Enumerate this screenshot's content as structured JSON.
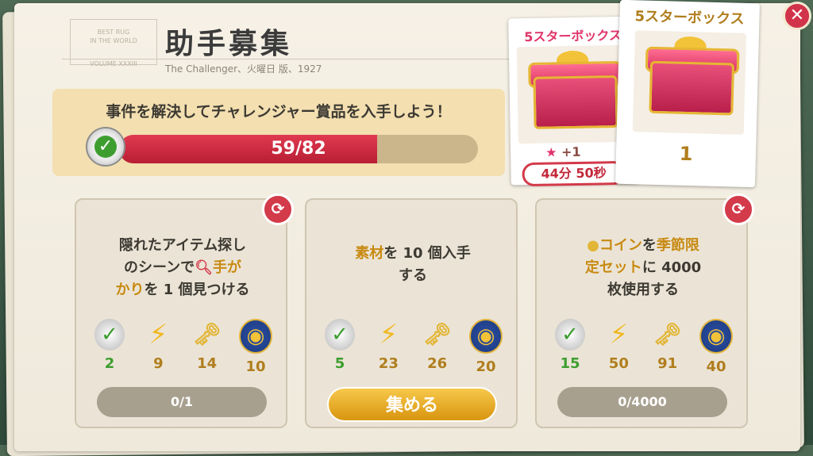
{
  "header": {
    "stamp_line1": "BEST RUG",
    "stamp_line2": "IN THE WORLD",
    "stamp_line3": "VOLUME XXXIII",
    "title": "助手募集",
    "subtitle": "The Challenger、火曜日 版、1927"
  },
  "banner": {
    "text": "事件を解決してチャレンジャー賞品を入手しよう！",
    "progress_current": 59,
    "progress_total": 82,
    "progress_label": "59/82"
  },
  "rewards": [
    {
      "title": "5スターボックス",
      "plus": "+1",
      "timer": "44分 50秒"
    },
    {
      "title": "5スターボックス",
      "count": "1"
    }
  ],
  "missions": [
    {
      "desc_line1": "隠れたアイテム探し",
      "desc_line2a": "のシーンで",
      "desc_line2b": "手が",
      "desc_line3a": "かり",
      "desc_line3b": "を 1 個見つける",
      "rewards": [
        "2",
        "9",
        "14",
        "10"
      ],
      "progress": "0/1"
    },
    {
      "desc_line1a": "素材",
      "desc_line1b": "を 10 個入手",
      "desc_line2": "する",
      "rewards": [
        "5",
        "23",
        "26",
        "20"
      ],
      "button": "集める"
    },
    {
      "desc_line1a": "コイン",
      "desc_line1b": "を",
      "desc_line1c": "季節限",
      "desc_line2a": "定セット",
      "desc_line2b": "に 4000",
      "desc_line3": "枚使用する",
      "rewards": [
        "15",
        "50",
        "91",
        "40"
      ],
      "progress": "0/4000"
    }
  ],
  "icons": [
    "checkmark-badge-icon",
    "lightning-icon",
    "key-icon",
    "magnifier-medal-icon"
  ],
  "colors": {
    "accent_red": "#d33a4a",
    "gold": "#b07e1e",
    "progress_fill": "#c82940"
  }
}
